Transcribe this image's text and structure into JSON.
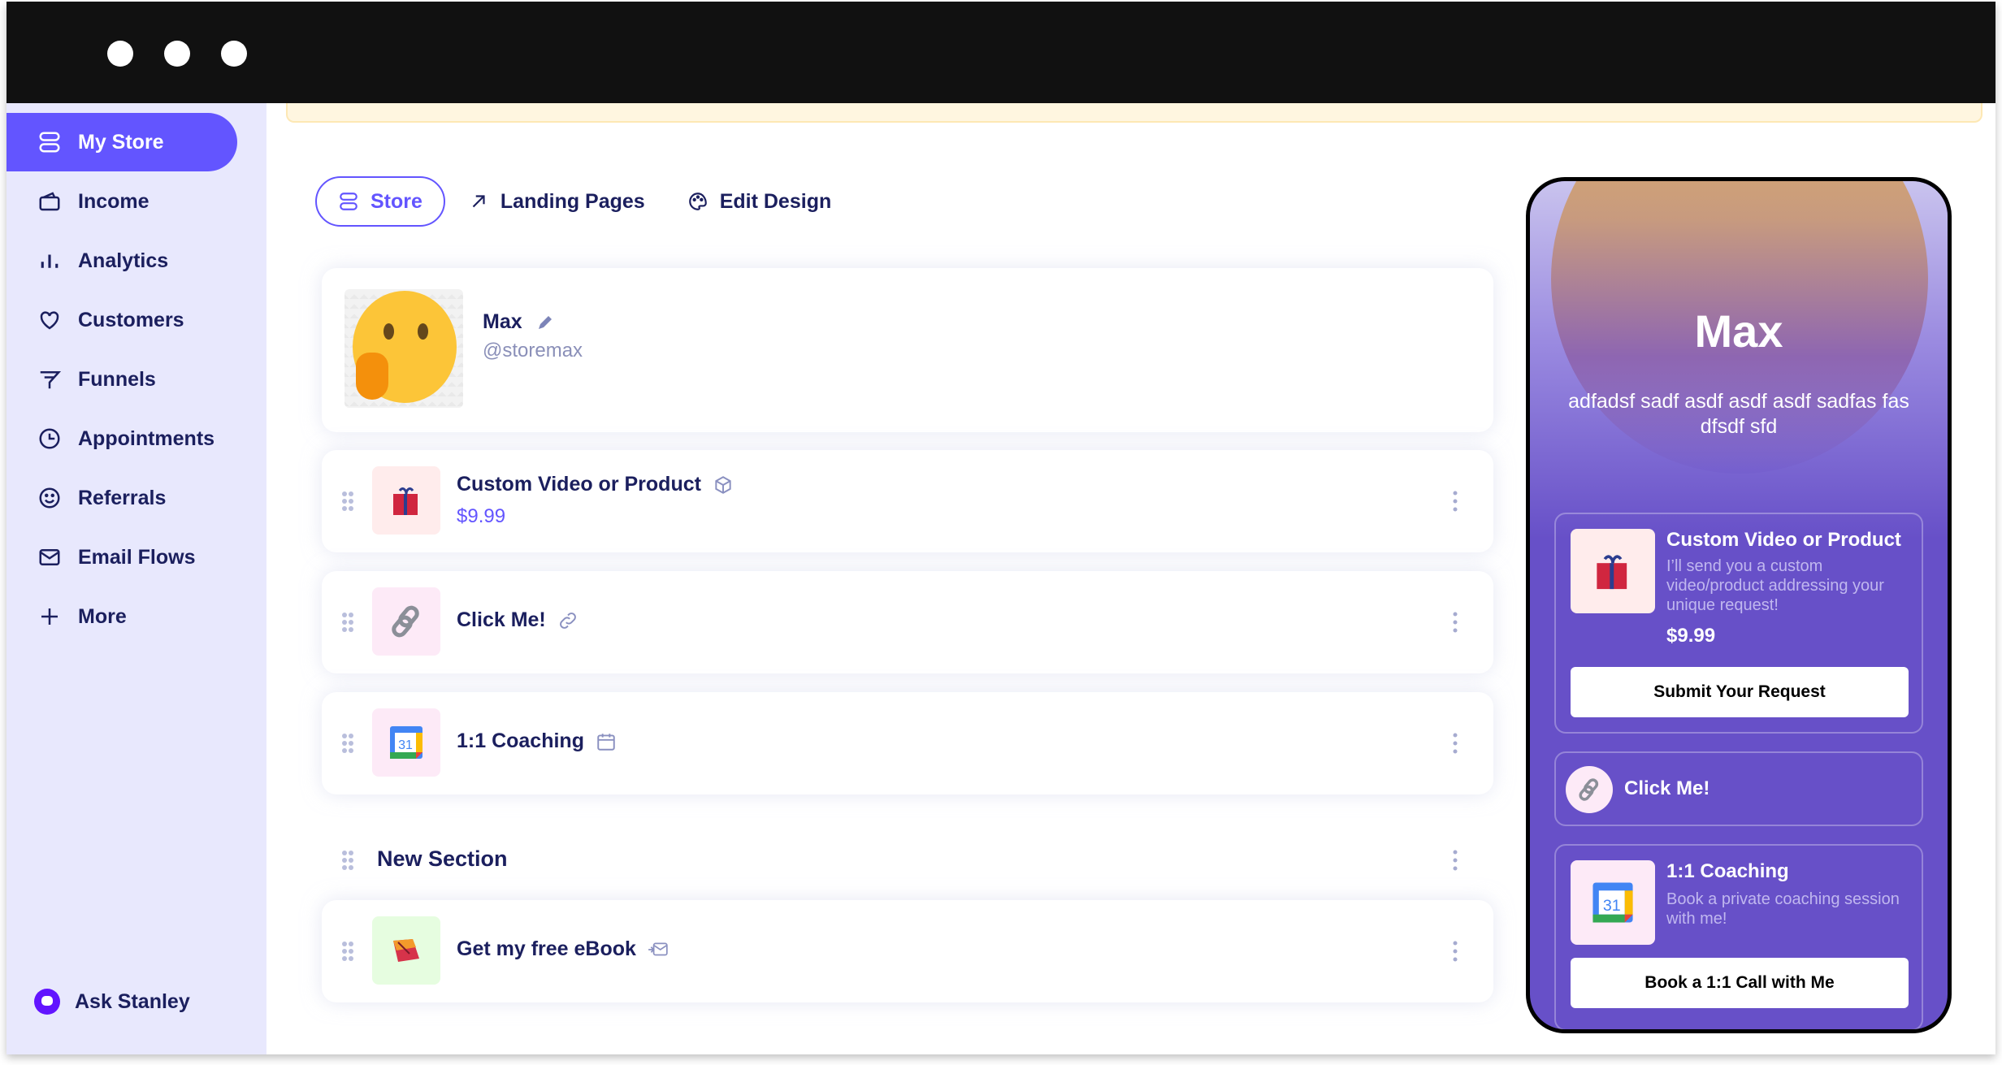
{
  "window": {
    "controls": [
      "dot",
      "dot",
      "dot"
    ]
  },
  "sidebar": {
    "items": [
      {
        "label": "My Store",
        "icon": "store-icon",
        "active": true
      },
      {
        "label": "Income",
        "icon": "wallet-icon"
      },
      {
        "label": "Analytics",
        "icon": "bar-chart-icon"
      },
      {
        "label": "Customers",
        "icon": "heart-icon"
      },
      {
        "label": "Funnels",
        "icon": "funnel-icon"
      },
      {
        "label": "Appointments",
        "icon": "clock-icon"
      },
      {
        "label": "Referrals",
        "icon": "smiley-icon"
      },
      {
        "label": "Email Flows",
        "icon": "mail-icon"
      },
      {
        "label": "More",
        "icon": "plus-icon"
      }
    ],
    "assistant": {
      "label": "Ask Stanley",
      "icon": "robot-icon"
    }
  },
  "tabs": [
    {
      "label": "Store",
      "icon": "store-icon",
      "active": true
    },
    {
      "label": "Landing Pages",
      "icon": "arrow-up-right-icon"
    },
    {
      "label": "Edit Design",
      "icon": "palette-icon"
    }
  ],
  "profile": {
    "name": "Max",
    "handle": "@storemax",
    "avatar": "thinking-face-emoji"
  },
  "items": [
    {
      "title": "Custom Video or Product",
      "price": "$9.99",
      "type_icon": "box-icon",
      "thumb": "gift-emoji",
      "thumb_bg": "#ffecec"
    },
    {
      "title": "Click Me!",
      "type_icon": "link-icon",
      "thumb": "link-emoji",
      "thumb_bg": "#fdeaf7"
    },
    {
      "title": "1:1 Coaching",
      "type_icon": "calendar-icon",
      "thumb": "google-calendar-logo",
      "thumb_bg": "#fdeaf7"
    }
  ],
  "section": {
    "title": "New Section"
  },
  "section_items": [
    {
      "title": "Get my free eBook",
      "type_icon": "mail-in-icon",
      "thumb": "book-emoji",
      "thumb_bg": "#e6fde0"
    }
  ],
  "preview": {
    "name": "Max",
    "bio": "adfadsf sadf asdf asdf asdf sadfas fas dfsdf sfd",
    "product": {
      "title": "Custom Video or Product",
      "description": "I’ll send you a custom video/product addressing your unique request!",
      "price": "$9.99",
      "button": "Submit Your Request"
    },
    "link": {
      "title": "Click Me!"
    },
    "coaching": {
      "title": "1:1 Coaching",
      "description": "Book a private coaching session with me!",
      "button": "Book a 1:1 Call with Me"
    }
  },
  "colors": {
    "accent": "#6355ff",
    "sidebar_bg": "#e8e8fd",
    "preview_bg": "#6750c8",
    "text_dark": "#1b1f5e"
  }
}
